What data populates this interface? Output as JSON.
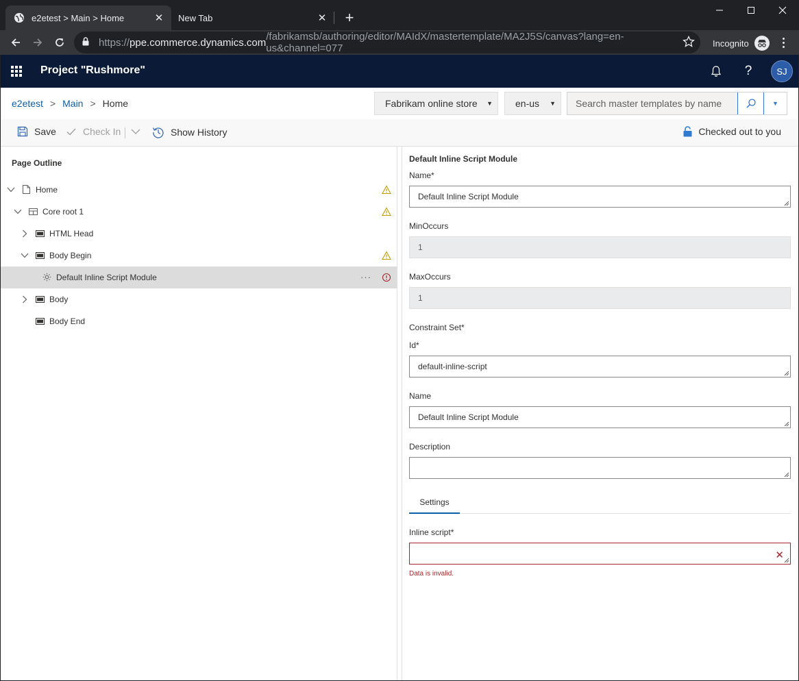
{
  "browser": {
    "tabs": [
      {
        "title": "e2etest > Main > Home"
      },
      {
        "title": "New Tab"
      }
    ],
    "url": {
      "prefix": "https://",
      "host": "ppe.commerce.dynamics.com",
      "path": "/fabrikamsb/authoring/editor/MAIdX/mastertemplate/MA2J5S/canvas?lang=en-us&channel=077"
    },
    "incognito_label": "Incognito"
  },
  "app": {
    "title": "Project \"Rushmore\"",
    "avatar_initials": "SJ",
    "breadcrumb": [
      "e2etest",
      "Main",
      "Home"
    ],
    "breadcrumb_separator": ">",
    "store_select": "Fabrikam online store",
    "locale_select": "en-us",
    "search_placeholder": "Search master templates by name"
  },
  "commands": {
    "save": "Save",
    "check_in": "Check In",
    "show_history": "Show History",
    "checked_out": "Checked out to you"
  },
  "outline": {
    "title": "Page Outline",
    "nodes": [
      {
        "label": "Home",
        "status": "warning"
      },
      {
        "label": "Core root 1",
        "status": "warning"
      },
      {
        "label": "HTML Head",
        "status": ""
      },
      {
        "label": "Body Begin",
        "status": "warning"
      },
      {
        "label": "Default Inline Script Module",
        "status": "error",
        "selected": true
      },
      {
        "label": "Body",
        "status": ""
      },
      {
        "label": "Body End",
        "status": ""
      }
    ],
    "more_label": "···"
  },
  "properties": {
    "module_title": "Default Inline Script Module",
    "name_label": "Name*",
    "name_value": "Default Inline Script Module",
    "min_label": "MinOccurs",
    "min_value": "1",
    "max_label": "MaxOccurs",
    "max_value": "1",
    "constraint_label": "Constraint Set*",
    "id_label": "Id*",
    "id_value": "default-inline-script",
    "cs_name_label": "Name",
    "cs_name_value": "Default Inline Script Module",
    "description_label": "Description",
    "description_value": "",
    "settings_tab": "Settings",
    "inline_script_label": "Inline script*",
    "inline_script_value": "",
    "error_message": "Data is invalid."
  },
  "colors": {
    "header_bg": "#0b1a37",
    "link": "#0f5fa8",
    "warning": "#c19c00",
    "error": "#a4262c",
    "accent": "#2f7bd1"
  }
}
